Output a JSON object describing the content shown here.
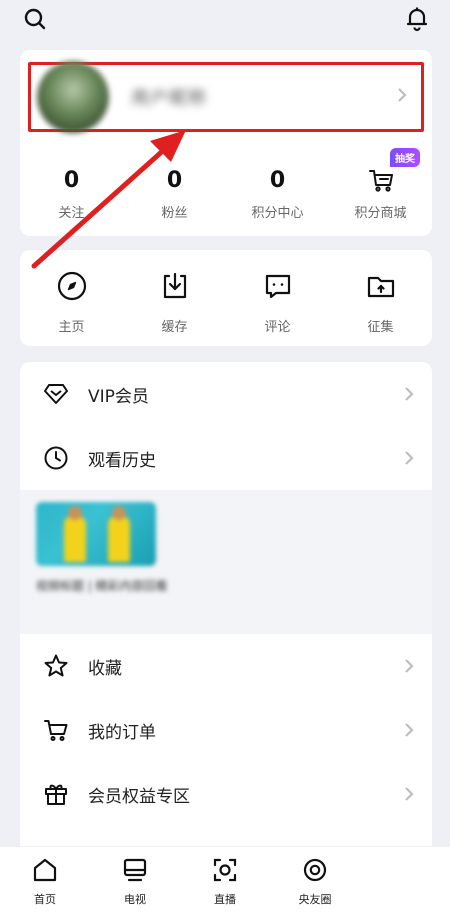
{
  "topbar": {
    "search_icon": "search-icon",
    "bell_icon": "bell-icon"
  },
  "profile": {
    "nickname": "用户昵称",
    "stats": [
      {
        "value": "0",
        "label": "关注"
      },
      {
        "value": "0",
        "label": "粉丝"
      },
      {
        "value": "0",
        "label": "积分中心"
      },
      {
        "label": "积分商城",
        "icon": "cart-icon"
      }
    ],
    "badge": "抽奖"
  },
  "shortcuts": [
    {
      "label": "主页",
      "icon": "compass-icon"
    },
    {
      "label": "缓存",
      "icon": "download-icon"
    },
    {
      "label": "评论",
      "icon": "comment-icon"
    },
    {
      "label": "征集",
      "icon": "folder-upload-icon"
    }
  ],
  "list": {
    "vip": "VIP会员",
    "history": "观看历史",
    "history_item_title": "视频标题 | 精彩内容回看",
    "favorites": "收藏",
    "orders": "我的订单",
    "benefits": "会员权益专区"
  },
  "bottom_nav": [
    {
      "label": "首页",
      "icon": "home-icon"
    },
    {
      "label": "电视",
      "icon": "tv-icon"
    },
    {
      "label": "直播",
      "icon": "live-icon"
    },
    {
      "label": "央友圈",
      "icon": "circle-icon"
    }
  ],
  "colors": {
    "annotation_red": "#e02020",
    "badge_purple": "#8a4dff"
  }
}
